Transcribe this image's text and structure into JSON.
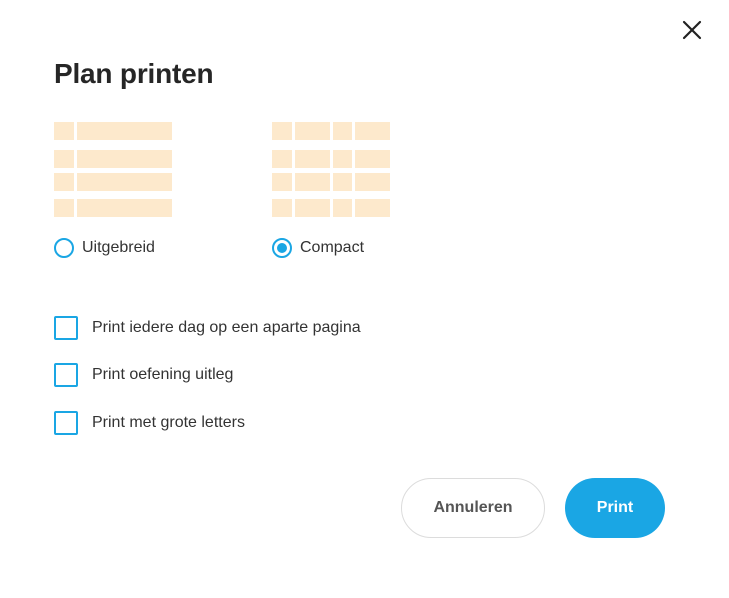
{
  "dialog": {
    "title": "Plan printen",
    "close_icon": "close-icon"
  },
  "layout_options": [
    {
      "label": "Uitgebreid",
      "selected": false
    },
    {
      "label": "Compact",
      "selected": true
    }
  ],
  "checkboxes": [
    {
      "label": "Print iedere dag op een aparte pagina",
      "checked": false
    },
    {
      "label": "Print oefening uitleg",
      "checked": false
    },
    {
      "label": "Print met grote letters",
      "checked": false
    }
  ],
  "buttons": {
    "cancel_label": "Annuleren",
    "print_label": "Print"
  },
  "colors": {
    "accent": "#1aa6e4",
    "preview_fill": "#fde9cc",
    "title_text": "#262626"
  }
}
